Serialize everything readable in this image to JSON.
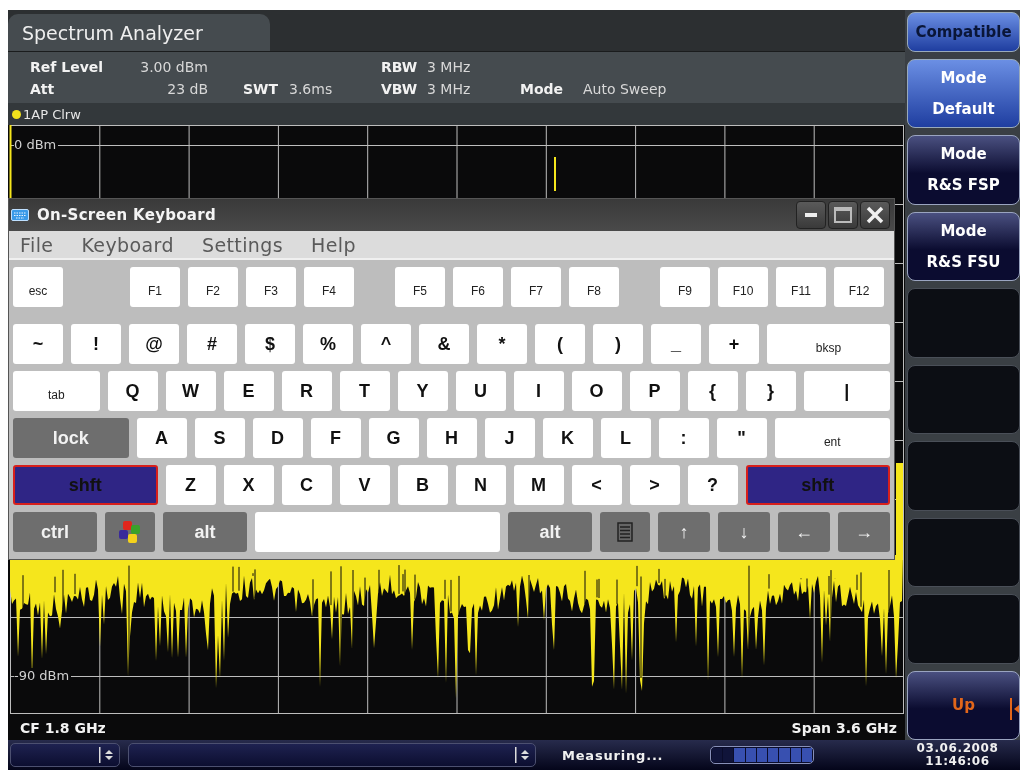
{
  "tab": {
    "title": "Spectrum Analyzer"
  },
  "settings": [
    {
      "label": "Ref Level",
      "value": "3.00 dBm"
    },
    {
      "label": "RBW",
      "value": "3 MHz"
    },
    {
      "label": "Att",
      "value": "23 dB"
    },
    {
      "label": "SWT",
      "value": "3.6ms"
    },
    {
      "label": "VBW",
      "value": "3 MHz"
    },
    {
      "label": "Mode",
      "value": "Auto Sweep"
    }
  ],
  "trace": {
    "label": "1AP Clrw"
  },
  "plot": {
    "y_labels": [
      "0 dBm",
      "-90 dBm"
    ],
    "center": "CF 1.8 GHz",
    "span": "Span 3.6 GHz"
  },
  "keyboard": {
    "title": "On-Screen Keyboard",
    "menu": [
      "File",
      "Keyboard",
      "Settings",
      "Help"
    ],
    "function_keys": [
      [
        "esc"
      ],
      [
        "F1",
        "F2",
        "F3",
        "F4"
      ],
      [
        "F5",
        "F6",
        "F7",
        "F8"
      ],
      [
        "F9",
        "F10",
        "F11",
        "F12"
      ]
    ],
    "rows": [
      [
        {
          "kind": "char",
          "label": "~"
        },
        {
          "kind": "char",
          "label": "!"
        },
        {
          "kind": "char",
          "label": "@"
        },
        {
          "kind": "char",
          "label": "#"
        },
        {
          "kind": "char",
          "label": "$"
        },
        {
          "kind": "char",
          "label": "%"
        },
        {
          "kind": "char",
          "label": "^"
        },
        {
          "kind": "char",
          "label": "&"
        },
        {
          "kind": "char",
          "label": "*"
        },
        {
          "kind": "char",
          "label": "("
        },
        {
          "kind": "char",
          "label": ")"
        },
        {
          "kind": "char",
          "label": "_"
        },
        {
          "kind": "char",
          "label": "+"
        },
        {
          "kind": "label",
          "label": "bksp"
        }
      ],
      [
        {
          "kind": "label",
          "label": "tab"
        },
        {
          "kind": "char",
          "label": "Q"
        },
        {
          "kind": "char",
          "label": "W"
        },
        {
          "kind": "char",
          "label": "E"
        },
        {
          "kind": "char",
          "label": "R"
        },
        {
          "kind": "char",
          "label": "T"
        },
        {
          "kind": "char",
          "label": "Y"
        },
        {
          "kind": "char",
          "label": "U"
        },
        {
          "kind": "char",
          "label": "I"
        },
        {
          "kind": "char",
          "label": "O"
        },
        {
          "kind": "char",
          "label": "P"
        },
        {
          "kind": "char",
          "label": "{"
        },
        {
          "kind": "char",
          "label": "}"
        },
        {
          "kind": "char",
          "label": "|"
        }
      ],
      [
        {
          "kind": "modifier",
          "label": "lock",
          "pressed": false
        },
        {
          "kind": "char",
          "label": "A"
        },
        {
          "kind": "char",
          "label": "S"
        },
        {
          "kind": "char",
          "label": "D"
        },
        {
          "kind": "char",
          "label": "F"
        },
        {
          "kind": "char",
          "label": "G"
        },
        {
          "kind": "char",
          "label": "H"
        },
        {
          "kind": "char",
          "label": "J"
        },
        {
          "kind": "char",
          "label": "K"
        },
        {
          "kind": "char",
          "label": "L"
        },
        {
          "kind": "char",
          "label": ":"
        },
        {
          "kind": "char",
          "label": "\""
        },
        {
          "kind": "label",
          "label": "ent"
        }
      ],
      [
        {
          "kind": "modifier",
          "label": "shft",
          "pressed": true
        },
        {
          "kind": "char",
          "label": "Z"
        },
        {
          "kind": "char",
          "label": "X"
        },
        {
          "kind": "char",
          "label": "C"
        },
        {
          "kind": "char",
          "label": "V"
        },
        {
          "kind": "char",
          "label": "B"
        },
        {
          "kind": "char",
          "label": "N"
        },
        {
          "kind": "char",
          "label": "M"
        },
        {
          "kind": "char",
          "label": "<"
        },
        {
          "kind": "char",
          "label": ">"
        },
        {
          "kind": "char",
          "label": "?"
        },
        {
          "kind": "modifier",
          "label": "shft",
          "pressed": true
        }
      ],
      [
        {
          "kind": "modifier",
          "label": "ctrl",
          "pressed": false
        },
        {
          "kind": "logo"
        },
        {
          "kind": "modifier",
          "label": "alt",
          "pressed": false
        },
        {
          "kind": "space"
        },
        {
          "kind": "modifier",
          "label": "alt",
          "pressed": false
        },
        {
          "kind": "menu"
        },
        {
          "kind": "arrow",
          "label": "↑"
        },
        {
          "kind": "arrow",
          "label": "↓"
        },
        {
          "kind": "arrow",
          "label": "←"
        },
        {
          "kind": "arrow",
          "label": "→"
        }
      ]
    ]
  },
  "softkeys": [
    {
      "kind": "header",
      "lines": [
        "Compatible"
      ]
    },
    {
      "kind": "mode",
      "lines": [
        "Mode",
        "Default"
      ],
      "selected": true
    },
    {
      "kind": "mode",
      "lines": [
        "Mode",
        "R&S FSP"
      ],
      "selected": false
    },
    {
      "kind": "mode",
      "lines": [
        "Mode",
        "R&S FSU"
      ],
      "selected": false
    },
    {
      "kind": "blank"
    },
    {
      "kind": "blank"
    },
    {
      "kind": "blank"
    },
    {
      "kind": "blank"
    },
    {
      "kind": "blank"
    },
    {
      "kind": "nav",
      "lines": [
        "Up"
      ]
    }
  ],
  "status_bar": {
    "status": "Measuring...",
    "progress": {
      "level": 0.78
    },
    "date": "03.06.2008",
    "time": "11:46:06"
  }
}
